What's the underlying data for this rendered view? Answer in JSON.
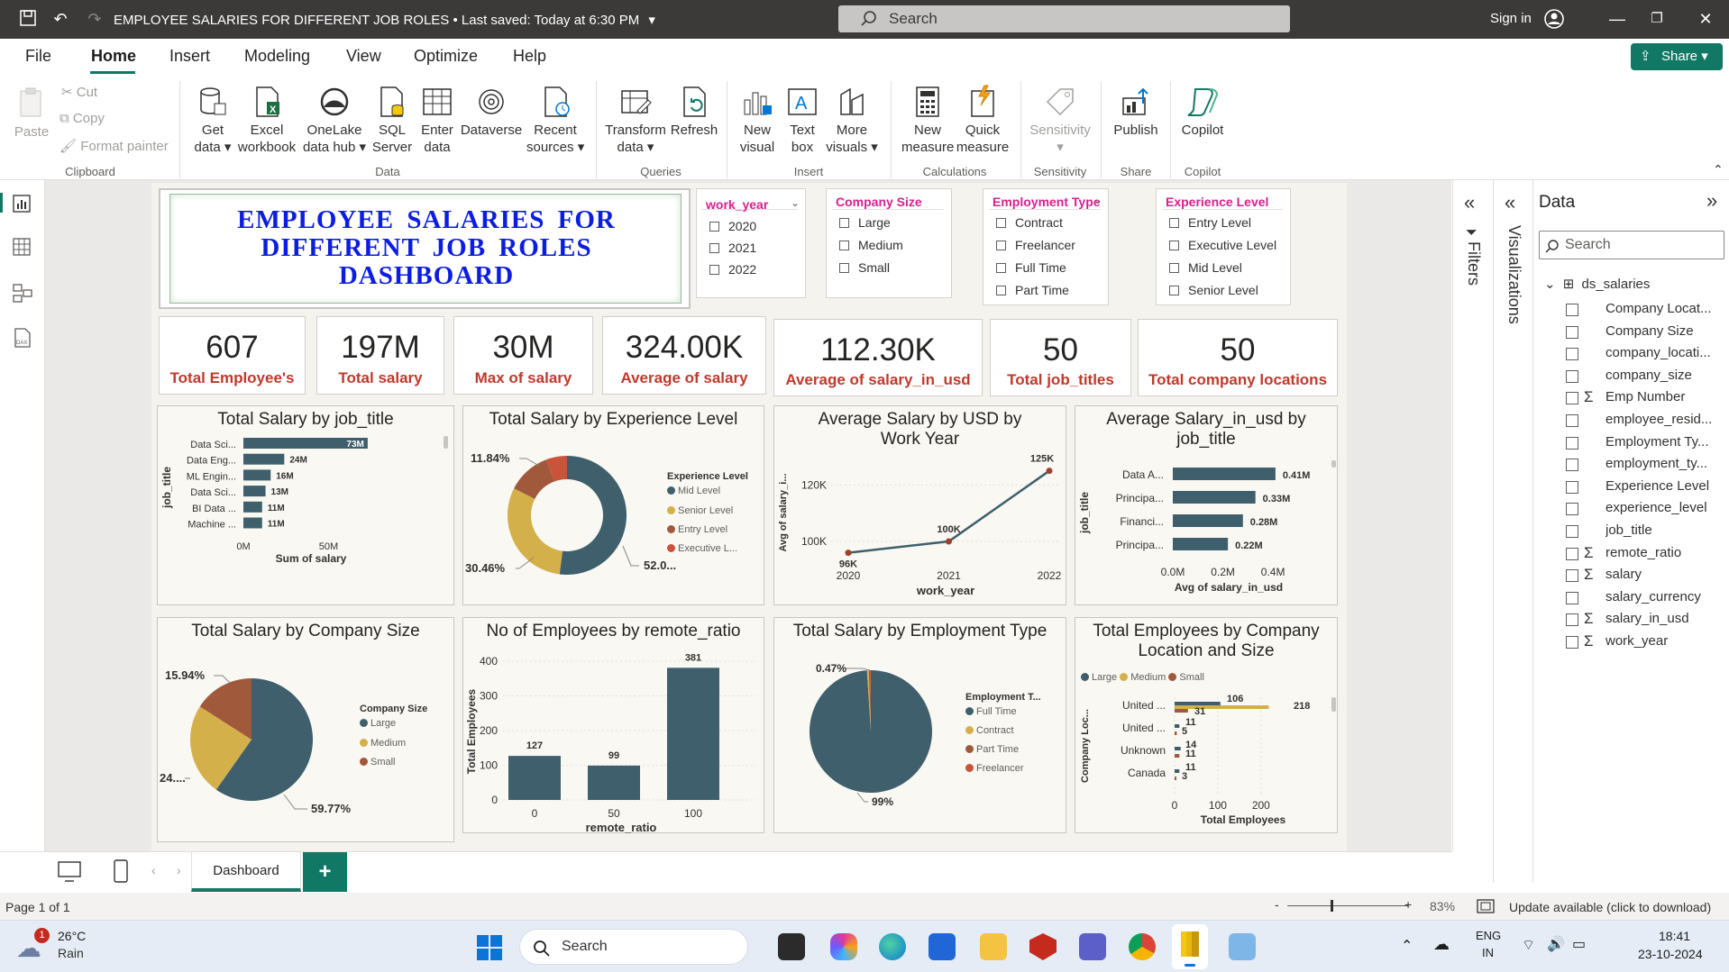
{
  "window": {
    "title": "EMPLOYEE SALARIES FOR DIFFERENT JOB ROLES",
    "saved_status": "• Last saved: Today at 6:30 PM",
    "search_placeholder": "Search",
    "signin": "Sign in"
  },
  "menu": [
    "File",
    "Home",
    "Insert",
    "Modeling",
    "View",
    "Optimize",
    "Help"
  ],
  "share_label": "Share",
  "ribbon": {
    "clipboard": {
      "paste": "Paste",
      "cut": "Cut",
      "copy": "Copy",
      "format_painter": "Format painter",
      "group": "Clipboard"
    },
    "data": {
      "group": "Data",
      "items": [
        {
          "l1": "Get",
          "l2": "data ▾"
        },
        {
          "l1": "Excel",
          "l2": "workbook"
        },
        {
          "l1": "OneLake",
          "l2": "data hub ▾"
        },
        {
          "l1": "SQL",
          "l2": "Server"
        },
        {
          "l1": "Enter",
          "l2": "data"
        },
        {
          "l1": "Dataverse",
          "l2": ""
        },
        {
          "l1": "Recent",
          "l2": "sources ▾"
        }
      ]
    },
    "queries": {
      "group": "Queries",
      "transform_l1": "Transform",
      "transform_l2": "data ▾",
      "refresh": "Refresh"
    },
    "insert": {
      "group": "Insert",
      "new_visual_l1": "New",
      "new_visual_l2": "visual",
      "text_box_l1": "Text",
      "text_box_l2": "box",
      "more_visuals_l1": "More",
      "more_visuals_l2": "visuals ▾"
    },
    "calculations": {
      "group": "Calculations",
      "new_measure_l1": "New",
      "new_measure_l2": "measure",
      "quick_measure_l1": "Quick",
      "quick_measure_l2": "measure"
    },
    "sensitivity": {
      "group": "Sensitivity",
      "label": "Sensitivity",
      "chev": "▾"
    },
    "share": {
      "group": "Share",
      "publish": "Publish"
    },
    "copilot": {
      "group": "Copilot",
      "label": "Copilot"
    }
  },
  "dashboard": {
    "title": "EMPLOYEE SALARIES FOR DIFFERENT JOB ROLES DASHBOARD",
    "slicers": [
      {
        "header": "work_year",
        "options": [
          "2020",
          "2021",
          "2022"
        ]
      },
      {
        "header": "Company Size",
        "options": [
          "Large",
          "Medium",
          "Small"
        ]
      },
      {
        "header": "Employment Type",
        "options": [
          "Contract",
          "Freelancer",
          "Full Time",
          "Part Time"
        ]
      },
      {
        "header": "Experience Level",
        "options": [
          "Entry Level",
          "Executive Level",
          "Mid Level",
          "Senior Level"
        ]
      }
    ],
    "kpis": [
      {
        "value": "607",
        "label": "Total Employee's"
      },
      {
        "value": "197M",
        "label": "Total salary"
      },
      {
        "value": "30M",
        "label": "Max of salary"
      },
      {
        "value": "324.00K",
        "label": "Average of salary"
      },
      {
        "value": "112.30K",
        "label": "Average of salary_in_usd"
      },
      {
        "value": "50",
        "label": "Total job_titles"
      },
      {
        "value": "50",
        "label": "Total company locations"
      }
    ]
  },
  "chart_data": [
    {
      "type": "bar",
      "title": "Total Salary by job_title",
      "orientation": "horizontal",
      "categories": [
        "Data Sci...",
        "Data Eng...",
        "ML Engin...",
        "Data Sci...",
        "BI Data ...",
        "Machine ..."
      ],
      "values": [
        73,
        24,
        16,
        13,
        11,
        11
      ],
      "data_labels": [
        "73M",
        "24M",
        "16M",
        "13M",
        "11M",
        "11M"
      ],
      "unit": "M",
      "xlabel": "Sum of salary",
      "ylabel": "job_title",
      "x_ticks": [
        "0M",
        "50M"
      ],
      "xlim": [
        0,
        90
      ]
    },
    {
      "type": "pie",
      "title": "Total Salary by Experience Level",
      "donut": true,
      "legend_title": "Experience Level",
      "legend": [
        "Mid Level",
        "Senior Level",
        "Entry Level",
        "Executive L..."
      ],
      "values": [
        52.0,
        30.46,
        11.84,
        5.7
      ],
      "data_labels": [
        "52.0...",
        "30.46%",
        "11.84%"
      ],
      "colors": [
        "#3e5f6b",
        "#d4b04a",
        "#a05a3b",
        "#c9533b"
      ]
    },
    {
      "type": "line",
      "title": "Average Salary by USD by Work Year",
      "x": [
        "2020",
        "2021",
        "2022"
      ],
      "values": [
        96,
        100,
        125
      ],
      "data_labels": [
        "96K",
        "100K",
        "125K"
      ],
      "y_ticks": [
        "100K",
        "120K"
      ],
      "ylim": [
        93,
        130
      ],
      "xlabel": "work_year",
      "ylabel": "Avg of salary_i..."
    },
    {
      "type": "bar",
      "title": "Average Salary_in_usd by job_title",
      "orientation": "horizontal",
      "categories": [
        "Data A...",
        "Principa...",
        "Financi...",
        "Principa..."
      ],
      "values": [
        0.41,
        0.33,
        0.28,
        0.22
      ],
      "data_labels": [
        "0.41M",
        "0.33M",
        "0.28M",
        "0.22M"
      ],
      "xlabel": "Avg of salary_in_usd",
      "ylabel": "job_title",
      "x_ticks": [
        "0.0M",
        "0.2M",
        "0.4M"
      ],
      "xlim": [
        0,
        0.45
      ]
    },
    {
      "type": "pie",
      "title": "Total Salary by Company Size",
      "legend_title": "Company Size",
      "legend": [
        "Large",
        "Medium",
        "Small"
      ],
      "values": [
        59.77,
        24.29,
        15.94
      ],
      "data_labels": [
        "59.77%",
        "24....",
        "15.94%"
      ],
      "colors": [
        "#3e5f6b",
        "#d4b04a",
        "#a05a3b"
      ]
    },
    {
      "type": "bar",
      "title": "No of Employees by remote_ratio",
      "categories": [
        "0",
        "50",
        "100"
      ],
      "values": [
        127,
        99,
        381
      ],
      "data_labels": [
        "127",
        "99",
        "381"
      ],
      "y_ticks": [
        "0",
        "100",
        "200",
        "300",
        "400"
      ],
      "ylim": [
        0,
        400
      ],
      "xlabel": "remote_ratio",
      "ylabel": "Total Employees"
    },
    {
      "type": "pie",
      "title": "Total Salary by Employment Type",
      "legend_title": "Employment T...",
      "legend": [
        "Full Time",
        "Contract",
        "Part Time",
        "Freelancer"
      ],
      "values": [
        99.0,
        0.47,
        0.3,
        0.23
      ],
      "data_labels": [
        "99%",
        "0.47%"
      ],
      "colors": [
        "#3e5f6b",
        "#d4b04a",
        "#a05a3b",
        "#c9533b"
      ]
    },
    {
      "type": "bar",
      "title": "Total Employees by Company Location and Size",
      "orientation": "horizontal",
      "legend": [
        "Large",
        "Medium",
        "Small"
      ],
      "categories": [
        "United ...",
        "United ...",
        "Unknown",
        "Canada"
      ],
      "series": [
        {
          "name": "Large",
          "values": [
            106,
            11,
            14,
            11
          ]
        },
        {
          "name": "Medium",
          "values": [
            218,
            0,
            0,
            0
          ]
        },
        {
          "name": "Small",
          "values": [
            31,
            5,
            11,
            3
          ]
        }
      ],
      "data_labels": [
        [
          "106",
          "218",
          "31"
        ],
        [
          "11",
          "5"
        ],
        [
          "14",
          "11"
        ],
        [
          "11",
          "3"
        ]
      ],
      "x_ticks": [
        "0",
        "100",
        "200"
      ],
      "xlim": [
        0,
        240
      ],
      "xlabel": "Total Employees",
      "ylabel": "Company Loc..."
    }
  ],
  "panes": {
    "filters": "Filters",
    "visualizations": "Visualizations",
    "data_title": "Data",
    "data_search": "Search",
    "table": "ds_salaries",
    "fields": [
      {
        "name": "Company Locat...",
        "sigma": false
      },
      {
        "name": "Company Size",
        "sigma": false
      },
      {
        "name": "company_locati...",
        "sigma": false
      },
      {
        "name": "company_size",
        "sigma": false
      },
      {
        "name": "Emp Number",
        "sigma": true
      },
      {
        "name": "employee_resid...",
        "sigma": false
      },
      {
        "name": "Employment Ty...",
        "sigma": false
      },
      {
        "name": "employment_ty...",
        "sigma": false
      },
      {
        "name": "Experience Level",
        "sigma": false
      },
      {
        "name": "experience_level",
        "sigma": false
      },
      {
        "name": "job_title",
        "sigma": false
      },
      {
        "name": "remote_ratio",
        "sigma": true
      },
      {
        "name": "salary",
        "sigma": true
      },
      {
        "name": "salary_currency",
        "sigma": false
      },
      {
        "name": "salary_in_usd",
        "sigma": true
      },
      {
        "name": "work_year",
        "sigma": true
      }
    ]
  },
  "tabs": {
    "page": "Dashboard",
    "add": "+"
  },
  "status": {
    "page": "Page 1 of 1",
    "zoom": "83%",
    "update": "Update available (click to download)"
  },
  "taskbar": {
    "weather_temp": "26°C",
    "weather_desc": "Rain",
    "weather_badge": "1",
    "search": "Search",
    "lang1": "ENG",
    "lang2": "IN",
    "time": "18:41",
    "date": "23-10-2024"
  }
}
